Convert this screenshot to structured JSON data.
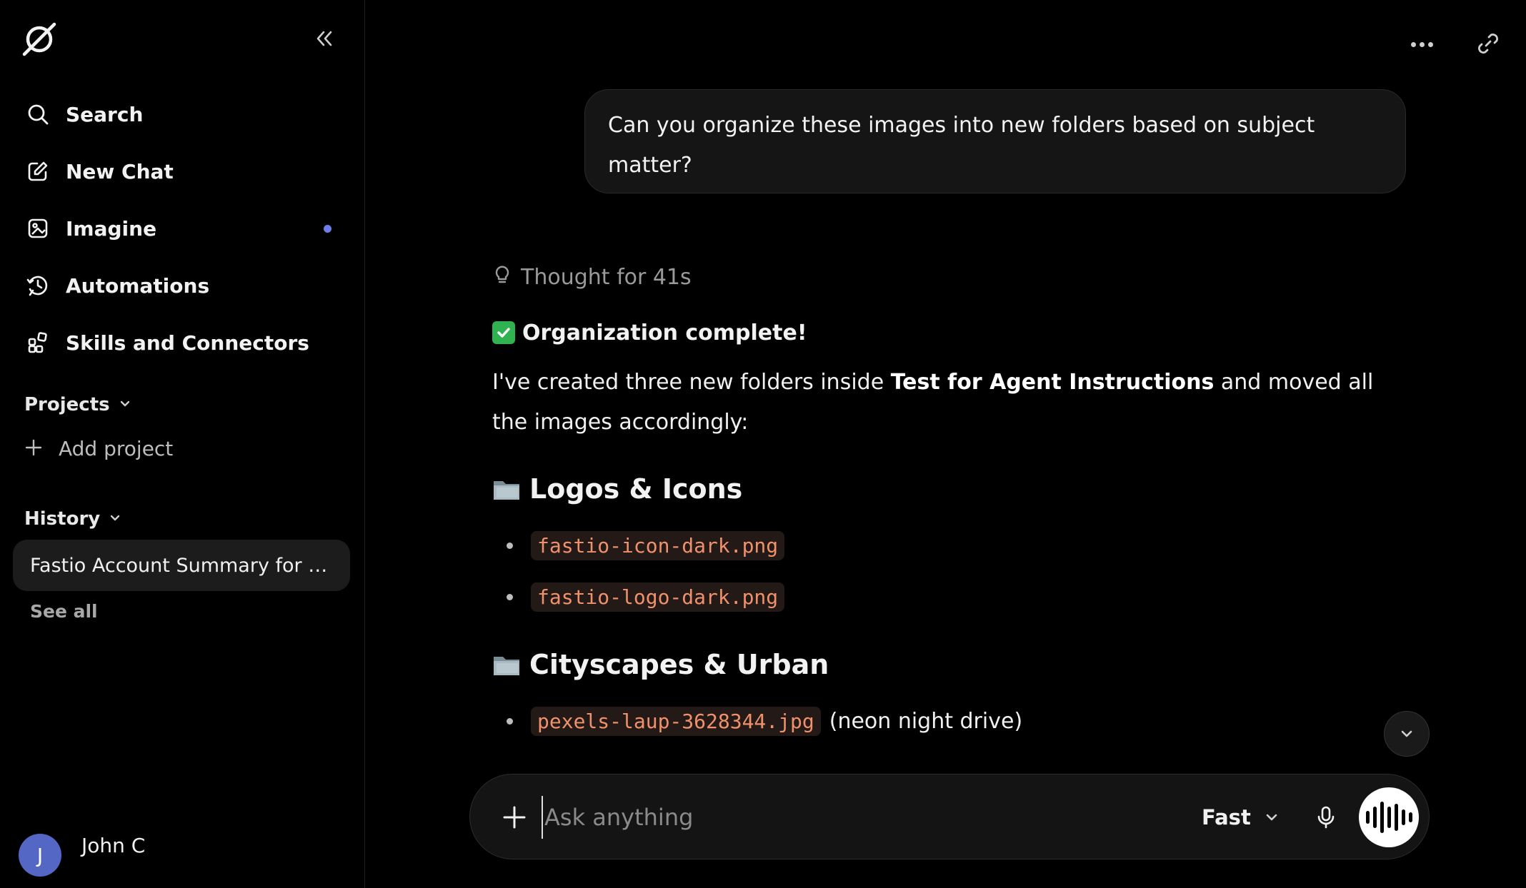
{
  "sidebar": {
    "nav": [
      {
        "label": "Search",
        "icon": "search-icon"
      },
      {
        "label": "New Chat",
        "icon": "edit-icon"
      },
      {
        "label": "Imagine",
        "icon": "image-icon",
        "badge_color": "#6f7de8"
      },
      {
        "label": "Automations",
        "icon": "clock-icon"
      },
      {
        "label": "Skills and Connectors",
        "icon": "grid-icon"
      }
    ],
    "projects": {
      "title": "Projects",
      "add_label": "Add project"
    },
    "history": {
      "title": "History",
      "items": [
        "Fastio Account Summary for …"
      ],
      "see_all": "See all"
    },
    "user": {
      "initial": "J",
      "name": "John C",
      "avatar_color": "#5567c4"
    }
  },
  "conversation": {
    "user_message": "Can you organize these images into new folders based on subject matter?",
    "thought": "Thought for 41s",
    "status_title": "Organization complete!",
    "intro_before": "I've created three new folders inside ",
    "intro_bold": "Test for Agent Instructions",
    "intro_after": " and moved all the images accordingly:",
    "folders": [
      {
        "name": "Logos & Icons",
        "files": [
          {
            "file": "fastio-icon-dark.png",
            "note": ""
          },
          {
            "file": "fastio-logo-dark.png",
            "note": ""
          }
        ]
      },
      {
        "name": "Cityscapes & Urban",
        "files": [
          {
            "file": "pexels-laup-3628344.jpg",
            "note": "(neon night drive)"
          }
        ]
      }
    ]
  },
  "composer": {
    "placeholder": "Ask anything",
    "mode": "Fast"
  },
  "colors": {
    "background": "#000000",
    "accent_dot": "#6f7de8",
    "code_text": "#f0916b",
    "check_green": "#2fb24f"
  }
}
